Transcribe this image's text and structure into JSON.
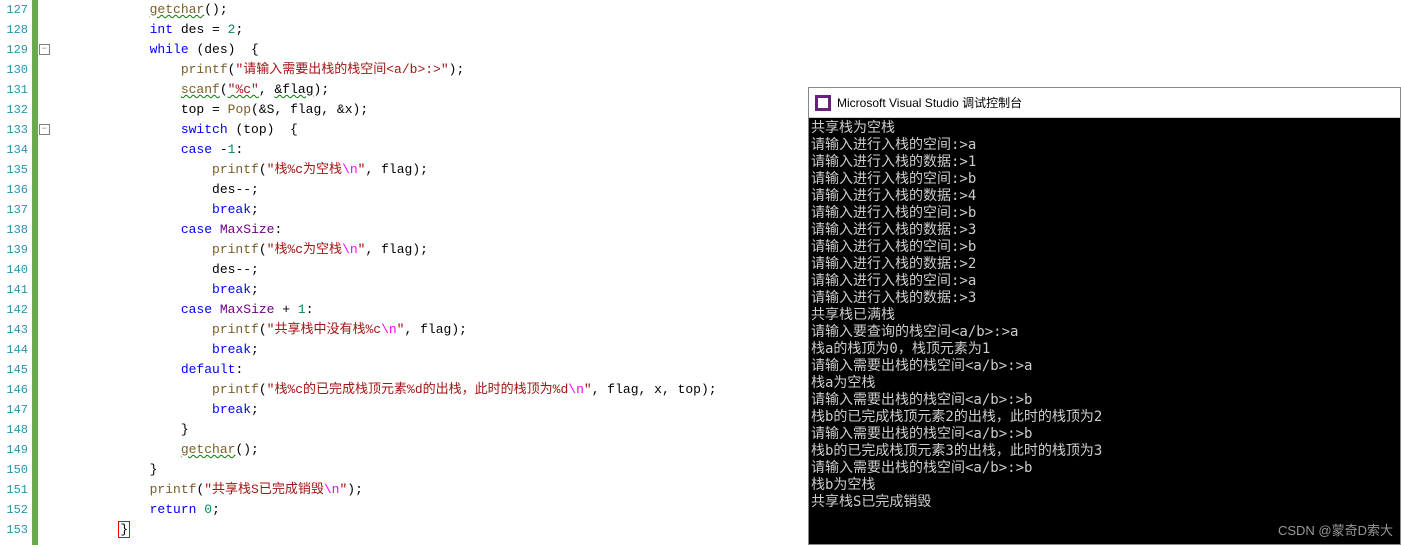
{
  "editor": {
    "first_line": 127,
    "lines": [
      {
        "n": 127,
        "indent": 3,
        "tokens": [
          {
            "t": "getchar",
            "c": "c-func underline-grn"
          },
          {
            "t": "()",
            "c": "c-paren"
          },
          {
            "t": ";",
            "c": "c-id"
          }
        ]
      },
      {
        "n": 128,
        "indent": 3,
        "tokens": [
          {
            "t": "int ",
            "c": "c-type"
          },
          {
            "t": "des",
            "c": "c-id"
          },
          {
            "t": " = ",
            "c": "c-id"
          },
          {
            "t": "2",
            "c": "c-num"
          },
          {
            "t": ";",
            "c": "c-id"
          }
        ]
      },
      {
        "n": 129,
        "indent": 3,
        "fold": true,
        "tokens": [
          {
            "t": "while",
            "c": "c-kw"
          },
          {
            "t": " (",
            "c": "c-paren"
          },
          {
            "t": "des",
            "c": "c-id"
          },
          {
            "t": ")  {",
            "c": "c-paren"
          }
        ]
      },
      {
        "n": 130,
        "indent": 4,
        "tokens": [
          {
            "t": "printf",
            "c": "c-func"
          },
          {
            "t": "(",
            "c": "c-paren"
          },
          {
            "t": "\"请输入需要出栈的栈空间<a/b>:>\"",
            "c": "c-str"
          },
          {
            "t": ")",
            "c": "c-paren"
          },
          {
            "t": ";",
            "c": "c-id"
          }
        ]
      },
      {
        "n": 131,
        "indent": 4,
        "tokens": [
          {
            "t": "scanf",
            "c": "c-func underline-grn"
          },
          {
            "t": "(",
            "c": "c-paren"
          },
          {
            "t": "\"%c\"",
            "c": "c-str underline-grn"
          },
          {
            "t": ", ",
            "c": "c-id"
          },
          {
            "t": "&flag",
            "c": "c-id underline-grn"
          },
          {
            "t": ")",
            "c": "c-paren"
          },
          {
            "t": ";",
            "c": "c-id"
          }
        ]
      },
      {
        "n": 132,
        "indent": 4,
        "tokens": [
          {
            "t": "top",
            "c": "c-id"
          },
          {
            "t": " = ",
            "c": "c-id"
          },
          {
            "t": "Pop",
            "c": "c-func"
          },
          {
            "t": "(&",
            "c": "c-paren"
          },
          {
            "t": "S",
            "c": "c-id"
          },
          {
            "t": ", ",
            "c": "c-id"
          },
          {
            "t": "flag",
            "c": "c-id"
          },
          {
            "t": ", &",
            "c": "c-id"
          },
          {
            "t": "x",
            "c": "c-id"
          },
          {
            "t": ")",
            "c": "c-paren"
          },
          {
            "t": ";",
            "c": "c-id"
          }
        ]
      },
      {
        "n": 133,
        "indent": 4,
        "fold": true,
        "tokens": [
          {
            "t": "switch",
            "c": "c-kw"
          },
          {
            "t": " (",
            "c": "c-paren"
          },
          {
            "t": "top",
            "c": "c-id"
          },
          {
            "t": ")  {",
            "c": "c-paren"
          }
        ]
      },
      {
        "n": 134,
        "indent": 4,
        "tokens": [
          {
            "t": "case",
            "c": "c-kw"
          },
          {
            "t": " -",
            "c": "c-id"
          },
          {
            "t": "1",
            "c": "c-num"
          },
          {
            "t": ":",
            "c": "c-id"
          }
        ]
      },
      {
        "n": 135,
        "indent": 5,
        "tokens": [
          {
            "t": "printf",
            "c": "c-func"
          },
          {
            "t": "(",
            "c": "c-paren"
          },
          {
            "t": "\"栈%c为空栈",
            "c": "c-str"
          },
          {
            "t": "\\n",
            "c": "c-esc"
          },
          {
            "t": "\"",
            "c": "c-str"
          },
          {
            "t": ", ",
            "c": "c-id"
          },
          {
            "t": "flag",
            "c": "c-id"
          },
          {
            "t": ")",
            "c": "c-paren"
          },
          {
            "t": ";",
            "c": "c-id"
          }
        ]
      },
      {
        "n": 136,
        "indent": 5,
        "tokens": [
          {
            "t": "des",
            "c": "c-id"
          },
          {
            "t": "--;",
            "c": "c-id"
          }
        ]
      },
      {
        "n": 137,
        "indent": 5,
        "tokens": [
          {
            "t": "break",
            "c": "c-kw"
          },
          {
            "t": ";",
            "c": "c-id"
          }
        ]
      },
      {
        "n": 138,
        "indent": 4,
        "tokens": [
          {
            "t": "case",
            "c": "c-kw"
          },
          {
            "t": " ",
            "c": "c-id"
          },
          {
            "t": "MaxSize",
            "c": "c-macro"
          },
          {
            "t": ":",
            "c": "c-id"
          }
        ]
      },
      {
        "n": 139,
        "indent": 5,
        "tokens": [
          {
            "t": "printf",
            "c": "c-func"
          },
          {
            "t": "(",
            "c": "c-paren"
          },
          {
            "t": "\"栈%c为空栈",
            "c": "c-str"
          },
          {
            "t": "\\n",
            "c": "c-esc"
          },
          {
            "t": "\"",
            "c": "c-str"
          },
          {
            "t": ", ",
            "c": "c-id"
          },
          {
            "t": "flag",
            "c": "c-id"
          },
          {
            "t": ")",
            "c": "c-paren"
          },
          {
            "t": ";",
            "c": "c-id"
          }
        ]
      },
      {
        "n": 140,
        "indent": 5,
        "tokens": [
          {
            "t": "des",
            "c": "c-id"
          },
          {
            "t": "--;",
            "c": "c-id"
          }
        ]
      },
      {
        "n": 141,
        "indent": 5,
        "tokens": [
          {
            "t": "break",
            "c": "c-kw"
          },
          {
            "t": ";",
            "c": "c-id"
          }
        ]
      },
      {
        "n": 142,
        "indent": 4,
        "tokens": [
          {
            "t": "case",
            "c": "c-kw"
          },
          {
            "t": " ",
            "c": "c-id"
          },
          {
            "t": "MaxSize",
            "c": "c-macro"
          },
          {
            "t": " + ",
            "c": "c-id"
          },
          {
            "t": "1",
            "c": "c-num"
          },
          {
            "t": ":",
            "c": "c-id"
          }
        ]
      },
      {
        "n": 143,
        "indent": 5,
        "tokens": [
          {
            "t": "printf",
            "c": "c-func"
          },
          {
            "t": "(",
            "c": "c-paren"
          },
          {
            "t": "\"共享栈中没有栈%c",
            "c": "c-str"
          },
          {
            "t": "\\n",
            "c": "c-esc"
          },
          {
            "t": "\"",
            "c": "c-str"
          },
          {
            "t": ", ",
            "c": "c-id"
          },
          {
            "t": "flag",
            "c": "c-id"
          },
          {
            "t": ")",
            "c": "c-paren"
          },
          {
            "t": ";",
            "c": "c-id"
          }
        ]
      },
      {
        "n": 144,
        "indent": 5,
        "tokens": [
          {
            "t": "break",
            "c": "c-kw"
          },
          {
            "t": ";",
            "c": "c-id"
          }
        ]
      },
      {
        "n": 145,
        "indent": 4,
        "tokens": [
          {
            "t": "default",
            "c": "c-kw"
          },
          {
            "t": ":",
            "c": "c-id"
          }
        ]
      },
      {
        "n": 146,
        "indent": 5,
        "tokens": [
          {
            "t": "printf",
            "c": "c-func"
          },
          {
            "t": "(",
            "c": "c-paren"
          },
          {
            "t": "\"栈%c的已完成栈顶元素%d的出栈，此时的栈顶为%d",
            "c": "c-str"
          },
          {
            "t": "\\n",
            "c": "c-esc"
          },
          {
            "t": "\"",
            "c": "c-str"
          },
          {
            "t": ", ",
            "c": "c-id"
          },
          {
            "t": "flag",
            "c": "c-id"
          },
          {
            "t": ", ",
            "c": "c-id"
          },
          {
            "t": "x",
            "c": "c-id"
          },
          {
            "t": ", ",
            "c": "c-id"
          },
          {
            "t": "top",
            "c": "c-id"
          },
          {
            "t": ")",
            "c": "c-paren"
          },
          {
            "t": ";",
            "c": "c-id"
          }
        ]
      },
      {
        "n": 147,
        "indent": 5,
        "tokens": [
          {
            "t": "break",
            "c": "c-kw"
          },
          {
            "t": ";",
            "c": "c-id"
          }
        ]
      },
      {
        "n": 148,
        "indent": 4,
        "tokens": [
          {
            "t": "}",
            "c": "c-paren"
          }
        ]
      },
      {
        "n": 149,
        "indent": 4,
        "tokens": [
          {
            "t": "getchar",
            "c": "c-func underline-grn"
          },
          {
            "t": "()",
            "c": "c-paren"
          },
          {
            "t": ";",
            "c": "c-id"
          }
        ]
      },
      {
        "n": 150,
        "indent": 3,
        "tokens": [
          {
            "t": "}",
            "c": "c-paren"
          }
        ]
      },
      {
        "n": 151,
        "indent": 3,
        "tokens": [
          {
            "t": "printf",
            "c": "c-func"
          },
          {
            "t": "(",
            "c": "c-paren"
          },
          {
            "t": "\"共享栈S已完成销毁",
            "c": "c-str"
          },
          {
            "t": "\\n",
            "c": "c-esc"
          },
          {
            "t": "\"",
            "c": "c-str"
          },
          {
            "t": ")",
            "c": "c-paren"
          },
          {
            "t": ";",
            "c": "c-id"
          }
        ]
      },
      {
        "n": 152,
        "indent": 3,
        "tokens": [
          {
            "t": "return",
            "c": "c-kw"
          },
          {
            "t": " ",
            "c": "c-id"
          },
          {
            "t": "0",
            "c": "c-num"
          },
          {
            "t": ";",
            "c": "c-id"
          }
        ]
      },
      {
        "n": 153,
        "indent": 2,
        "tokens": [
          {
            "t": "}",
            "c": "c-paren box-red"
          }
        ]
      }
    ]
  },
  "console": {
    "title": "Microsoft Visual Studio 调试控制台",
    "lines": [
      "共享栈为空栈",
      "请输入进行入栈的空间:>a",
      "请输入进行入栈的数据:>1",
      "请输入进行入栈的空间:>b",
      "请输入进行入栈的数据:>4",
      "请输入进行入栈的空间:>b",
      "请输入进行入栈的数据:>3",
      "请输入进行入栈的空间:>b",
      "请输入进行入栈的数据:>2",
      "请输入进行入栈的空间:>a",
      "请输入进行入栈的数据:>3",
      "共享栈已满栈",
      "请输入要查询的栈空间<a/b>:>a",
      "栈a的栈顶为0，栈顶元素为1",
      "请输入需要出栈的栈空间<a/b>:>a",
      "栈a为空栈",
      "请输入需要出栈的栈空间<a/b>:>b",
      "栈b的已完成栈顶元素2的出栈，此时的栈顶为2",
      "请输入需要出栈的栈空间<a/b>:>b",
      "栈b的已完成栈顶元素3的出栈，此时的栈顶为3",
      "请输入需要出栈的栈空间<a/b>:>b",
      "栈b为空栈",
      "共享栈S已完成销毁"
    ]
  },
  "watermark": "CSDN @蒙奇D索大"
}
